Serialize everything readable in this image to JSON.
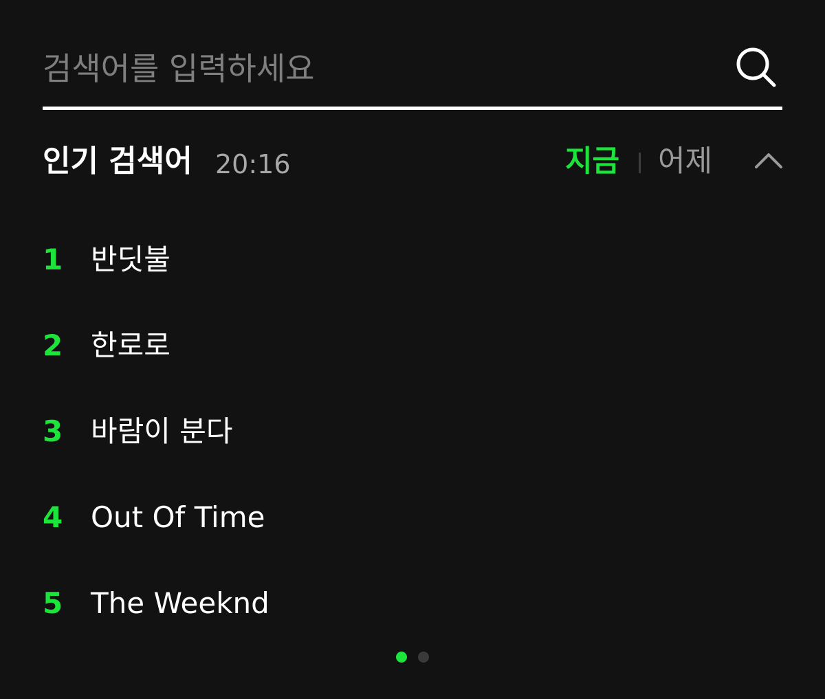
{
  "search": {
    "placeholder": "검색어를 입력하세요",
    "value": "",
    "icon": "search-icon"
  },
  "popular": {
    "title": "인기 검색어",
    "time": "20:16",
    "tabs": [
      {
        "label": "지금",
        "active": true
      },
      {
        "label": "어제",
        "active": false
      }
    ],
    "collapse_icon": "chevron-up-icon",
    "items": [
      {
        "rank": "1",
        "label": "반딧불"
      },
      {
        "rank": "2",
        "label": "한로로"
      },
      {
        "rank": "3",
        "label": "바람이 분다"
      },
      {
        "rank": "4",
        "label": "Out Of Time"
      },
      {
        "rank": "5",
        "label": "The Weeknd"
      }
    ]
  },
  "pager": {
    "page_count": 2,
    "current_page": 1
  },
  "colors": {
    "background": "#121212",
    "accent": "#1ce43a",
    "text": "#ffffff",
    "muted": "#9a9a9a",
    "dot_active": "#1ce43a",
    "dot_inactive": "#3a3a3a"
  }
}
